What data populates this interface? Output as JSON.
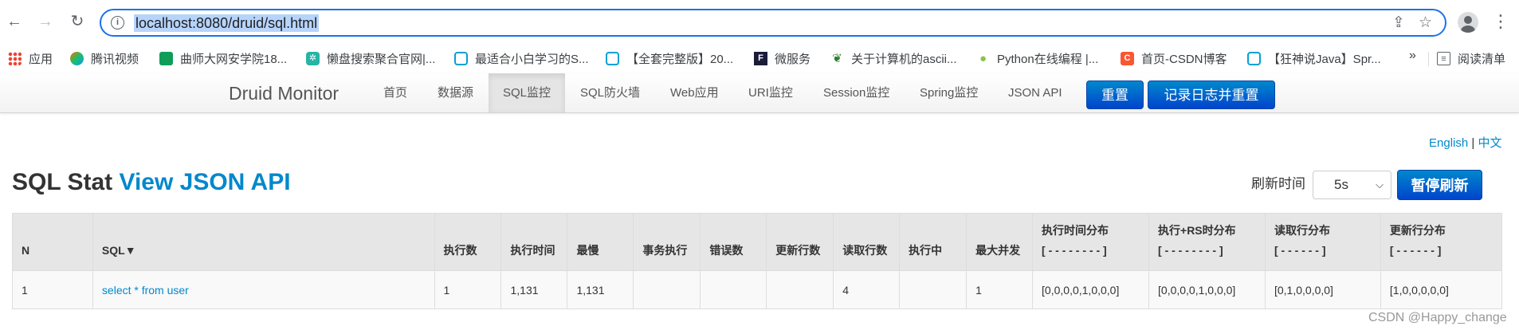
{
  "browser": {
    "url": "localhost:8080/druid/sql.html",
    "bookmarks": [
      {
        "label": "应用",
        "icon": "apps-grid-icon"
      },
      {
        "label": "腾讯视频",
        "icon": "tencent-video-icon"
      },
      {
        "label": "曲师大网安学院18...",
        "icon": "sheets-icon"
      },
      {
        "label": "懒盘搜索聚合官网|...",
        "icon": "gear-site-icon"
      },
      {
        "label": "最适合小白学习的S...",
        "icon": "bilibili-icon"
      },
      {
        "label": "【全套完整版】20...",
        "icon": "bilibili-icon"
      },
      {
        "label": "微服务",
        "icon": "f-site-icon"
      },
      {
        "label": "关于计算机的ascii...",
        "icon": "leaf-icon"
      },
      {
        "label": "Python在线编程 |...",
        "icon": "python-icon"
      },
      {
        "label": "首页-CSDN博客",
        "icon": "csdn-icon"
      },
      {
        "label": "【狂神说Java】Spr...",
        "icon": "bilibili-icon"
      }
    ],
    "bookmarks_more": "»",
    "reading_list": "阅读清单"
  },
  "druid": {
    "brand": "Druid Monitor",
    "nav": [
      "首页",
      "数据源",
      "SQL监控",
      "SQL防火墙",
      "Web应用",
      "URI监控",
      "Session监控",
      "Spring监控",
      "JSON API"
    ],
    "active_nav": "SQL监控",
    "reset_label": "重置",
    "log_reset_label": "记录日志并重置"
  },
  "lang": {
    "english": "English",
    "sep": "|",
    "chinese": "中文"
  },
  "title": {
    "main": "SQL Stat",
    "api_link": "View JSON API"
  },
  "refresh": {
    "label": "刷新时间",
    "value": "5s",
    "pause_label": "暂停刷新"
  },
  "table": {
    "headers": [
      {
        "l1": "N",
        "l2": ""
      },
      {
        "l1": "SQL▼",
        "l2": ""
      },
      {
        "l1": "执行数",
        "l2": ""
      },
      {
        "l1": "执行时间",
        "l2": ""
      },
      {
        "l1": "最慢",
        "l2": ""
      },
      {
        "l1": "事务执行",
        "l2": ""
      },
      {
        "l1": "错误数",
        "l2": ""
      },
      {
        "l1": "更新行数",
        "l2": ""
      },
      {
        "l1": "读取行数",
        "l2": ""
      },
      {
        "l1": "执行中",
        "l2": ""
      },
      {
        "l1": "最大并发",
        "l2": ""
      },
      {
        "l1": "执行时间分布",
        "l2": "[ - - - - - - - - ]"
      },
      {
        "l1": "执行+RS时分布",
        "l2": "[ - - - - - - - - ]"
      },
      {
        "l1": "读取行分布",
        "l2": "[ - - - - - - ]"
      },
      {
        "l1": "更新行分布",
        "l2": "[ - - - - - - ]"
      }
    ],
    "rows": [
      [
        "1",
        "select * from user",
        "1",
        "1,131",
        "1,131",
        "",
        "",
        "",
        "4",
        "",
        "1",
        "[0,0,0,0,1,0,0,0]",
        "[0,0,0,0,1,0,0,0]",
        "[0,1,0,0,0,0]",
        "[1,0,0,0,0,0]"
      ]
    ]
  },
  "watermark": "CSDN @Happy_change",
  "colors": {
    "link": "#0088cc",
    "slow": "#ff0000",
    "button": "#0066cc"
  }
}
